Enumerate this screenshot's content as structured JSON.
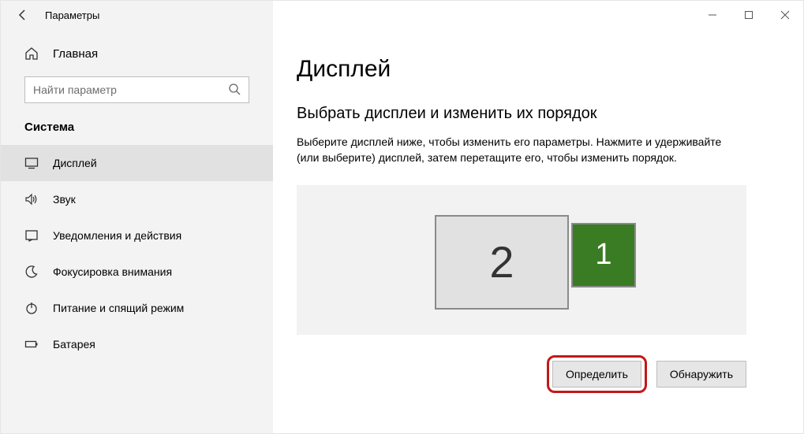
{
  "window": {
    "title": "Параметры"
  },
  "sidebar": {
    "home_label": "Главная",
    "search_placeholder": "Найти параметр",
    "section_label": "Система",
    "items": [
      {
        "label": "Дисплей"
      },
      {
        "label": "Звук"
      },
      {
        "label": "Уведомления и действия"
      },
      {
        "label": "Фокусировка внимания"
      },
      {
        "label": "Питание и спящий режим"
      },
      {
        "label": "Батарея"
      }
    ]
  },
  "main": {
    "heading": "Дисплей",
    "subheading": "Выбрать дисплеи и изменить их порядок",
    "description": "Выберите дисплей ниже, чтобы изменить его параметры. Нажмите и удерживайте (или выберите) дисплей, затем перетащите его, чтобы изменить порядок.",
    "monitors": {
      "m1": "1",
      "m2": "2"
    },
    "buttons": {
      "identify": "Определить",
      "detect": "Обнаружить"
    }
  }
}
